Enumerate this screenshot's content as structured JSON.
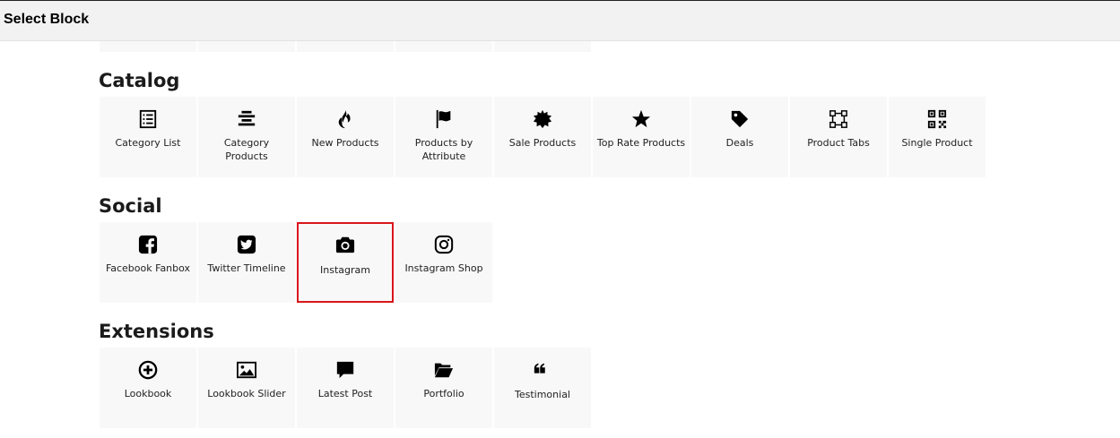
{
  "header": {
    "title": "Select Block"
  },
  "sections": {
    "catalog": {
      "title": "Catalog",
      "items": [
        {
          "label": "Category List",
          "icon": "list-icon"
        },
        {
          "label": "Category Products",
          "icon": "align-center-icon"
        },
        {
          "label": "New Products",
          "icon": "fire-icon"
        },
        {
          "label": "Products by Attribute",
          "icon": "flag-icon"
        },
        {
          "label": "Sale Products",
          "icon": "starburst-icon"
        },
        {
          "label": "Top Rate Products",
          "icon": "star-icon"
        },
        {
          "label": "Deals",
          "icon": "tag-icon"
        },
        {
          "label": "Product Tabs",
          "icon": "vector-square-icon"
        },
        {
          "label": "Single Product",
          "icon": "qrcode-icon"
        }
      ]
    },
    "social": {
      "title": "Social",
      "items": [
        {
          "label": "Facebook Fanbox",
          "icon": "facebook-icon"
        },
        {
          "label": "Twitter Timeline",
          "icon": "twitter-icon"
        },
        {
          "label": "Instagram",
          "icon": "camera-icon"
        },
        {
          "label": "Instagram Shop",
          "icon": "instagram-icon"
        }
      ]
    },
    "extensions": {
      "title": "Extensions",
      "items": [
        {
          "label": "Lookbook",
          "icon": "plus-circle-icon"
        },
        {
          "label": "Lookbook Slider",
          "icon": "image-icon"
        },
        {
          "label": "Latest Post",
          "icon": "comment-icon"
        },
        {
          "label": "Portfolio",
          "icon": "folder-open-icon"
        },
        {
          "label": "Testimonial",
          "icon": "quote-icon"
        }
      ]
    }
  },
  "selected_item": "Instagram",
  "colors": {
    "selection_border": "#d9161c",
    "tile_bg": "#f8f8f8",
    "header_bg": "#f2f2f2"
  }
}
